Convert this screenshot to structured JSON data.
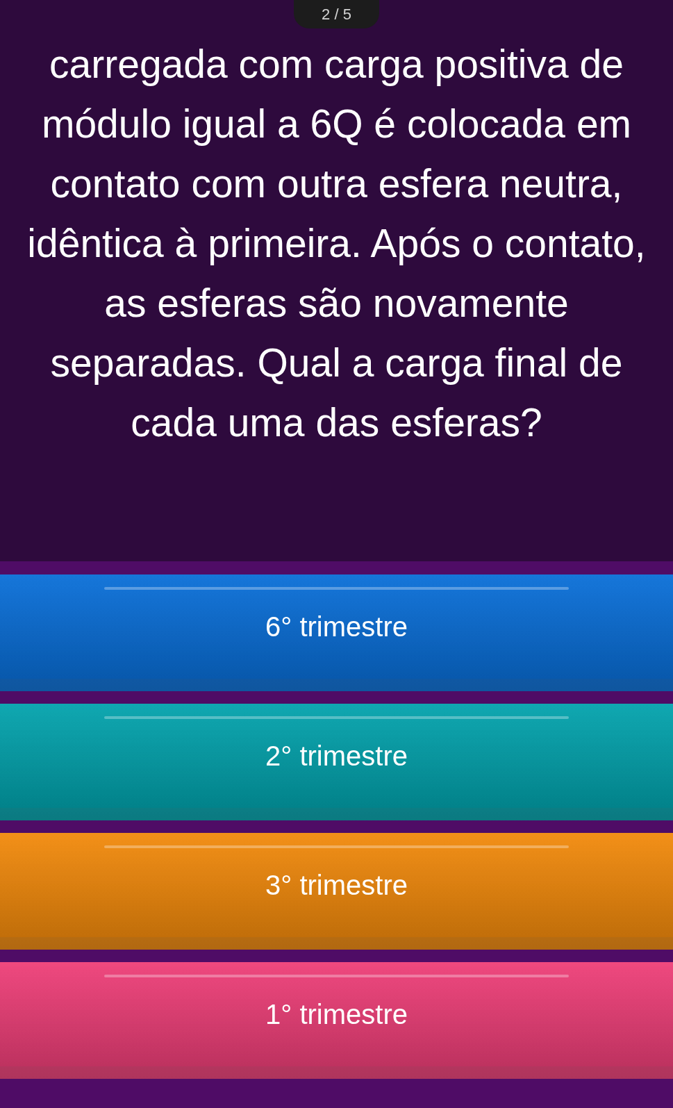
{
  "counter": "2 / 5",
  "question": "carregada com carga positiva de módulo igual a 6Q é colocada em contato com outra esfera neutra, idêntica à primeira. Após o contato, as esferas são novamente separadas. Qual a carga final de cada uma das esferas?",
  "options": [
    {
      "label": "6° trimestre",
      "color": "#0a6fd8"
    },
    {
      "label": "2° trimestre",
      "color": "#03a3ad"
    },
    {
      "label": "3° trimestre",
      "color": "#f28a0c"
    },
    {
      "label": "1° trimestre",
      "color": "#ee3f78"
    }
  ]
}
